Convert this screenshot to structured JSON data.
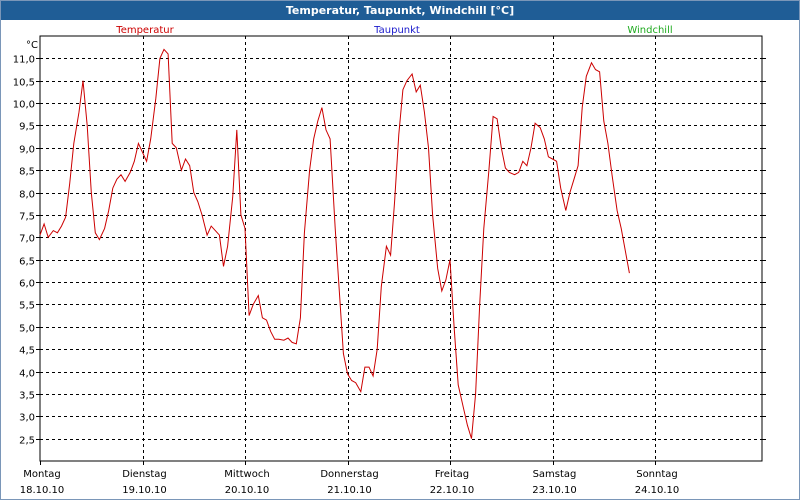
{
  "window": {
    "title": "Temperatur, Taupunkt, Windchill [°C]"
  },
  "chart_data": {
    "type": "line",
    "title": "Temperatur, Taupunkt, Windchill [°C]",
    "ylabel": "°C",
    "ylim": [
      2.0,
      11.5
    ],
    "xlim": [
      0,
      7
    ],
    "yticks": [
      2.5,
      3.0,
      3.5,
      4.0,
      4.5,
      5.0,
      5.5,
      6.0,
      6.5,
      7.0,
      7.5,
      8.0,
      8.5,
      9.0,
      9.5,
      10.0,
      10.5,
      11.0
    ],
    "ytick_labels": [
      "2,5",
      "3,0",
      "3,5",
      "4,0",
      "4,5",
      "5,0",
      "5,5",
      "6,0",
      "6,5",
      "7,0",
      "7,5",
      "8,0",
      "8,5",
      "9,0",
      "9,5",
      "10,0",
      "10,5",
      "11,0"
    ],
    "x_days": [
      {
        "day": "Montag",
        "date": "18.10.10"
      },
      {
        "day": "Dienstag",
        "date": "19.10.10"
      },
      {
        "day": "Mittwoch",
        "date": "20.10.10"
      },
      {
        "day": "Donnerstag",
        "date": "21.10.10"
      },
      {
        "day": "Freitag",
        "date": "22.10.10"
      },
      {
        "day": "Samstag",
        "date": "23.10.10"
      },
      {
        "day": "Sonntag",
        "date": "24.10.10"
      }
    ],
    "grid": true,
    "legend": {
      "placement": "top"
    },
    "series": [
      {
        "name": "Temperatur",
        "color": "#cc0000",
        "points": [
          [
            0.0,
            7.05
          ],
          [
            0.04,
            7.3
          ],
          [
            0.08,
            7.0
          ],
          [
            0.13,
            7.15
          ],
          [
            0.17,
            7.1
          ],
          [
            0.21,
            7.25
          ],
          [
            0.25,
            7.45
          ],
          [
            0.29,
            8.2
          ],
          [
            0.33,
            9.1
          ],
          [
            0.38,
            9.8
          ],
          [
            0.42,
            10.5
          ],
          [
            0.46,
            9.5
          ],
          [
            0.5,
            8.0
          ],
          [
            0.54,
            7.1
          ],
          [
            0.58,
            6.95
          ],
          [
            0.63,
            7.2
          ],
          [
            0.67,
            7.6
          ],
          [
            0.71,
            8.1
          ],
          [
            0.75,
            8.3
          ],
          [
            0.79,
            8.4
          ],
          [
            0.83,
            8.25
          ],
          [
            0.88,
            8.45
          ],
          [
            0.92,
            8.7
          ],
          [
            0.96,
            9.1
          ],
          [
            1.0,
            8.9
          ],
          [
            1.04,
            8.7
          ],
          [
            1.08,
            9.2
          ],
          [
            1.13,
            10.1
          ],
          [
            1.17,
            11.0
          ],
          [
            1.21,
            11.2
          ],
          [
            1.25,
            11.1
          ],
          [
            1.29,
            9.1
          ],
          [
            1.33,
            9.0
          ],
          [
            1.38,
            8.5
          ],
          [
            1.42,
            8.75
          ],
          [
            1.46,
            8.6
          ],
          [
            1.5,
            8.0
          ],
          [
            1.54,
            7.8
          ],
          [
            1.58,
            7.5
          ],
          [
            1.63,
            7.05
          ],
          [
            1.67,
            7.25
          ],
          [
            1.71,
            7.15
          ],
          [
            1.75,
            7.05
          ],
          [
            1.79,
            6.35
          ],
          [
            1.83,
            6.8
          ],
          [
            1.88,
            7.9
          ],
          [
            1.92,
            9.4
          ],
          [
            1.96,
            7.5
          ],
          [
            2.0,
            7.2
          ],
          [
            2.04,
            5.25
          ],
          [
            2.08,
            5.5
          ],
          [
            2.13,
            5.7
          ],
          [
            2.17,
            5.2
          ],
          [
            2.21,
            5.15
          ],
          [
            2.25,
            4.9
          ],
          [
            2.29,
            4.72
          ],
          [
            2.33,
            4.72
          ],
          [
            2.38,
            4.7
          ],
          [
            2.42,
            4.75
          ],
          [
            2.46,
            4.65
          ],
          [
            2.5,
            4.62
          ],
          [
            2.54,
            5.2
          ],
          [
            2.58,
            7.1
          ],
          [
            2.63,
            8.5
          ],
          [
            2.67,
            9.2
          ],
          [
            2.71,
            9.6
          ],
          [
            2.75,
            9.9
          ],
          [
            2.79,
            9.4
          ],
          [
            2.83,
            9.2
          ],
          [
            2.88,
            7.2
          ],
          [
            2.92,
            5.8
          ],
          [
            2.96,
            4.4
          ],
          [
            3.0,
            3.95
          ],
          [
            3.04,
            3.8
          ],
          [
            3.08,
            3.75
          ],
          [
            3.13,
            3.55
          ],
          [
            3.17,
            4.1
          ],
          [
            3.21,
            4.1
          ],
          [
            3.25,
            3.9
          ],
          [
            3.29,
            4.5
          ],
          [
            3.33,
            5.9
          ],
          [
            3.38,
            6.8
          ],
          [
            3.42,
            6.6
          ],
          [
            3.46,
            7.8
          ],
          [
            3.5,
            9.3
          ],
          [
            3.54,
            10.3
          ],
          [
            3.58,
            10.5
          ],
          [
            3.63,
            10.65
          ],
          [
            3.67,
            10.25
          ],
          [
            3.71,
            10.4
          ],
          [
            3.75,
            9.8
          ],
          [
            3.79,
            9.0
          ],
          [
            3.83,
            7.5
          ],
          [
            3.88,
            6.3
          ],
          [
            3.92,
            5.8
          ],
          [
            3.96,
            6.05
          ],
          [
            4.0,
            6.5
          ],
          [
            4.04,
            5.0
          ],
          [
            4.08,
            3.7
          ],
          [
            4.13,
            3.2
          ],
          [
            4.17,
            2.8
          ],
          [
            4.21,
            2.5
          ],
          [
            4.25,
            3.5
          ],
          [
            4.29,
            5.5
          ],
          [
            4.33,
            7.2
          ],
          [
            4.38,
            8.5
          ],
          [
            4.42,
            9.7
          ],
          [
            4.46,
            9.65
          ],
          [
            4.5,
            9.0
          ],
          [
            4.54,
            8.55
          ],
          [
            4.58,
            8.45
          ],
          [
            4.63,
            8.4
          ],
          [
            4.67,
            8.45
          ],
          [
            4.71,
            8.7
          ],
          [
            4.75,
            8.6
          ],
          [
            4.79,
            9.0
          ],
          [
            4.83,
            9.55
          ],
          [
            4.88,
            9.45
          ],
          [
            4.92,
            9.2
          ],
          [
            4.96,
            8.8
          ],
          [
            5.0,
            8.75
          ],
          [
            5.04,
            8.7
          ],
          [
            5.08,
            8.1
          ],
          [
            5.13,
            7.6
          ],
          [
            5.17,
            8.0
          ],
          [
            5.21,
            8.3
          ],
          [
            5.25,
            8.6
          ],
          [
            5.29,
            9.9
          ],
          [
            5.33,
            10.6
          ],
          [
            5.38,
            10.9
          ],
          [
            5.42,
            10.75
          ],
          [
            5.46,
            10.7
          ],
          [
            5.5,
            9.6
          ],
          [
            5.54,
            9.1
          ],
          [
            5.58,
            8.4
          ],
          [
            5.63,
            7.6
          ],
          [
            5.67,
            7.2
          ],
          [
            5.71,
            6.7
          ],
          [
            5.75,
            6.2
          ]
        ]
      },
      {
        "name": "Taupunkt",
        "color": "#1a1acc",
        "points": []
      },
      {
        "name": "Windchill",
        "color": "#1faa1f",
        "points": []
      }
    ]
  }
}
